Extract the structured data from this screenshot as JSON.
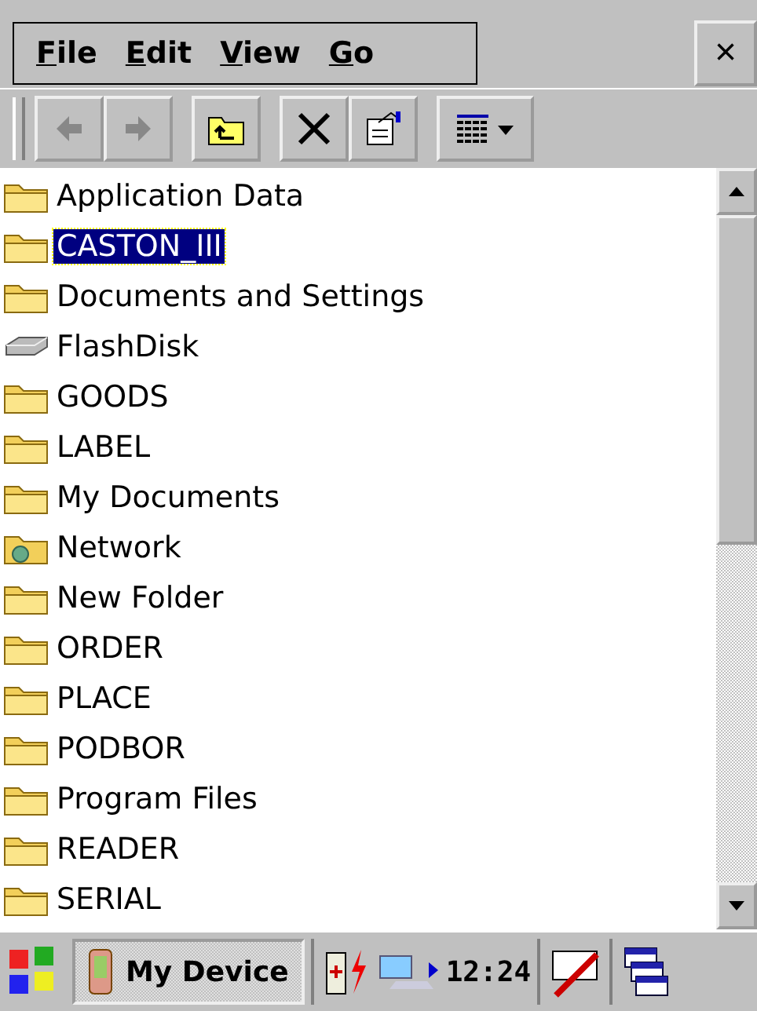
{
  "menu": [
    {
      "label": "File"
    },
    {
      "label": "Edit"
    },
    {
      "label": "View"
    },
    {
      "label": "Go"
    }
  ],
  "close_label": "×",
  "items": [
    {
      "label": "Application Data",
      "kind": "folder",
      "selected": false
    },
    {
      "label": "CASTON_III",
      "kind": "folder",
      "selected": true
    },
    {
      "label": "Documents and Settings",
      "kind": "folder",
      "selected": false
    },
    {
      "label": "FlashDisk",
      "kind": "drive",
      "selected": false
    },
    {
      "label": "GOODS",
      "kind": "folder",
      "selected": false
    },
    {
      "label": "LABEL",
      "kind": "folder",
      "selected": false
    },
    {
      "label": "My Documents",
      "kind": "folder",
      "selected": false
    },
    {
      "label": "Network",
      "kind": "network",
      "selected": false
    },
    {
      "label": "New Folder",
      "kind": "folder",
      "selected": false
    },
    {
      "label": "ORDER",
      "kind": "folder",
      "selected": false
    },
    {
      "label": "PLACE",
      "kind": "folder",
      "selected": false
    },
    {
      "label": "PODBOR",
      "kind": "folder",
      "selected": false
    },
    {
      "label": "Program Files",
      "kind": "folder",
      "selected": false
    },
    {
      "label": "READER",
      "kind": "folder",
      "selected": false
    },
    {
      "label": "SERIAL",
      "kind": "folder",
      "selected": false
    }
  ],
  "taskbar": {
    "task": "My Device",
    "time": "12:24"
  }
}
